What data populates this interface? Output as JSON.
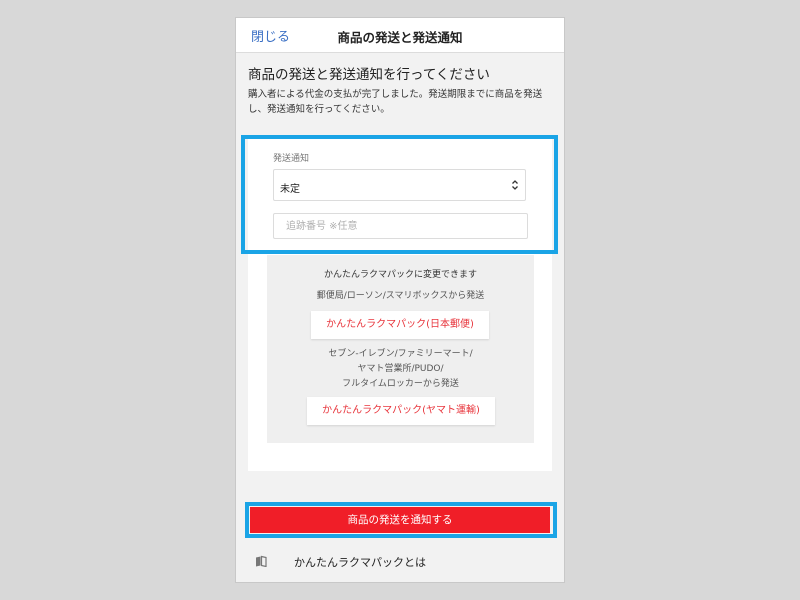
{
  "header": {
    "close_label": "閉じる",
    "title": "商品の発送と発送通知"
  },
  "main": {
    "heading": "商品の発送と発送通知を行ってください",
    "description": "購入者による代金の支払が完了しました。発送期限までに商品を発送し、発送通知を行ってください。"
  },
  "shipping_form": {
    "label": "発送通知",
    "select_value": "未定",
    "tracking_placeholder": "追跡番号 ※任意"
  },
  "pack_info": {
    "title": "かんたんラクマパックに変更できます",
    "japan_post_desc": "郵便局/ローソン/スマリボックスから発送",
    "japan_post_button": "かんたんラクマパック(日本郵便)",
    "yamato_desc_line1": "セブン-イレブン/ファミリーマート/",
    "yamato_desc_line2": "ヤマト営業所/PUDO/",
    "yamato_desc_line3": "フルタイムロッカーから発送",
    "yamato_button": "かんたんラクマパック(ヤマト運輸)"
  },
  "actions": {
    "notify_button": "商品の発送を通知する"
  },
  "footer_link": {
    "icon": "book-icon",
    "label": "かんたんラクマパックとは"
  },
  "colors": {
    "accent_red": "#f01e28",
    "link_blue": "#3a6fc4",
    "highlight_blue": "#1aa4e6"
  }
}
